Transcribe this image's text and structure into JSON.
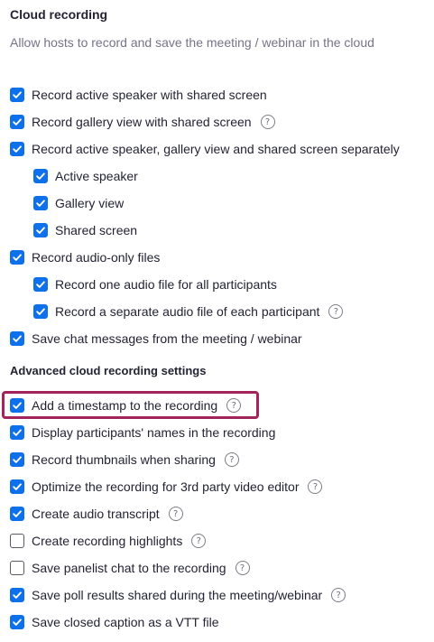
{
  "section": {
    "title": "Cloud recording",
    "description": "Allow hosts to record and save the meeting / webinar in the cloud",
    "advanced_title": "Advanced cloud recording settings"
  },
  "colors": {
    "accent": "#0e71eb",
    "highlight": "#a1245b"
  },
  "options": [
    {
      "label": "Record active speaker with shared screen",
      "checked": true,
      "help": false
    },
    {
      "label": "Record gallery view with shared screen",
      "checked": true,
      "help": true
    },
    {
      "label": "Record active speaker, gallery view and shared screen separately",
      "checked": true,
      "help": false
    },
    {
      "label": "Active speaker",
      "checked": true,
      "help": false
    },
    {
      "label": "Gallery view",
      "checked": true,
      "help": false
    },
    {
      "label": "Shared screen",
      "checked": true,
      "help": false
    },
    {
      "label": "Record audio-only files",
      "checked": true,
      "help": false
    },
    {
      "label": "Record one audio file for all participants",
      "checked": true,
      "help": false
    },
    {
      "label": "Record a separate audio file of each participant",
      "checked": true,
      "help": true
    },
    {
      "label": "Save chat messages from the meeting / webinar",
      "checked": true,
      "help": false
    }
  ],
  "advanced_options": [
    {
      "label": "Add a timestamp to the recording",
      "checked": true,
      "help": true,
      "highlighted": true
    },
    {
      "label": "Display participants' names in the recording",
      "checked": true,
      "help": false
    },
    {
      "label": "Record thumbnails when sharing",
      "checked": true,
      "help": true
    },
    {
      "label": "Optimize the recording for 3rd party video editor",
      "checked": true,
      "help": true
    },
    {
      "label": "Create audio transcript",
      "checked": true,
      "help": true
    },
    {
      "label": "Create recording highlights",
      "checked": false,
      "help": true
    },
    {
      "label": "Save panelist chat to the recording",
      "checked": false,
      "help": true
    },
    {
      "label": "Save poll results shared during the meeting/webinar",
      "checked": true,
      "help": true
    },
    {
      "label": "Save closed caption as a VTT file",
      "checked": true,
      "help": false
    }
  ],
  "help_glyph": "?"
}
